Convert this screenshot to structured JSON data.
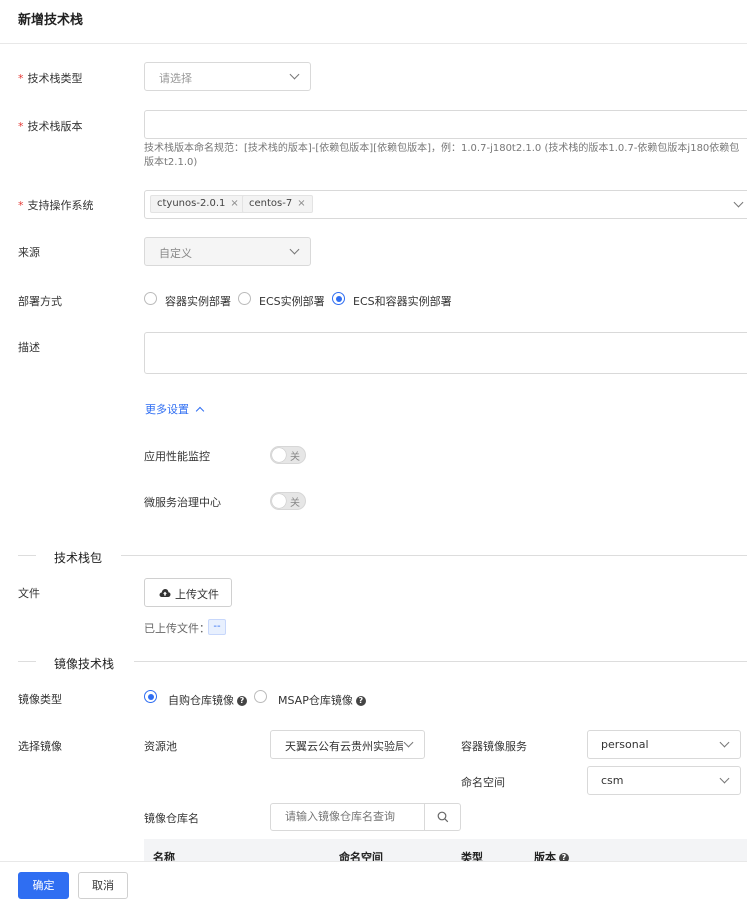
{
  "page": {
    "title": "新增技术栈"
  },
  "form": {
    "stack_type": {
      "label": "技术栈类型",
      "placeholder": "请选择"
    },
    "stack_version": {
      "label": "技术栈版本",
      "value": "",
      "hint": "技术栈版本命名规范：[技术栈的版本]-[依赖包版本][依赖包版本]，例：1.0.7-j180t2.1.0 (技术栈的版本1.0.7-依赖包版本j180依赖包版本t2.1.0)"
    },
    "os": {
      "label": "支持操作系统",
      "tags": [
        "ctyunos-2.0.1",
        "centos-7"
      ],
      "remove_glyph": "×"
    },
    "source": {
      "label": "来源",
      "value": "自定义"
    },
    "deploy": {
      "label": "部署方式",
      "options": [
        "容器实例部署",
        "ECS实例部署",
        "ECS和容器实例部署"
      ],
      "selected": 2
    },
    "description": {
      "label": "描述",
      "value": ""
    },
    "more_settings": {
      "label": "更多设置"
    },
    "apm": {
      "label": "应用性能监控",
      "state": "关"
    },
    "msc": {
      "label": "微服务治理中心",
      "state": "关"
    }
  },
  "package_section": {
    "title": "技术栈包",
    "file_label": "文件",
    "upload_button": "上传文件",
    "uploaded_label": "已上传文件：",
    "uploaded_value": "--"
  },
  "image_section": {
    "title": "镜像技术栈",
    "image_type_label": "镜像类型",
    "image_type_options": [
      "自购仓库镜像",
      "MSAP仓库镜像"
    ],
    "image_type_selected": 0,
    "select_image_label": "选择镜像",
    "pool_label": "资源池",
    "pool_value": "天翼云公有云贵州实验局",
    "registry_label": "容器镜像服务",
    "registry_value": "personal",
    "namespace_label": "命名空间",
    "namespace_value": "csm",
    "repo_label": "镜像仓库名",
    "repo_placeholder": "请输入镜像仓库名查询",
    "table_headers": [
      "名称",
      "命名空间",
      "类型",
      "版本"
    ]
  },
  "footer": {
    "confirm": "确定",
    "cancel": "取消"
  },
  "colors": {
    "accent": "#2f6ef2",
    "required": "#e53935"
  }
}
